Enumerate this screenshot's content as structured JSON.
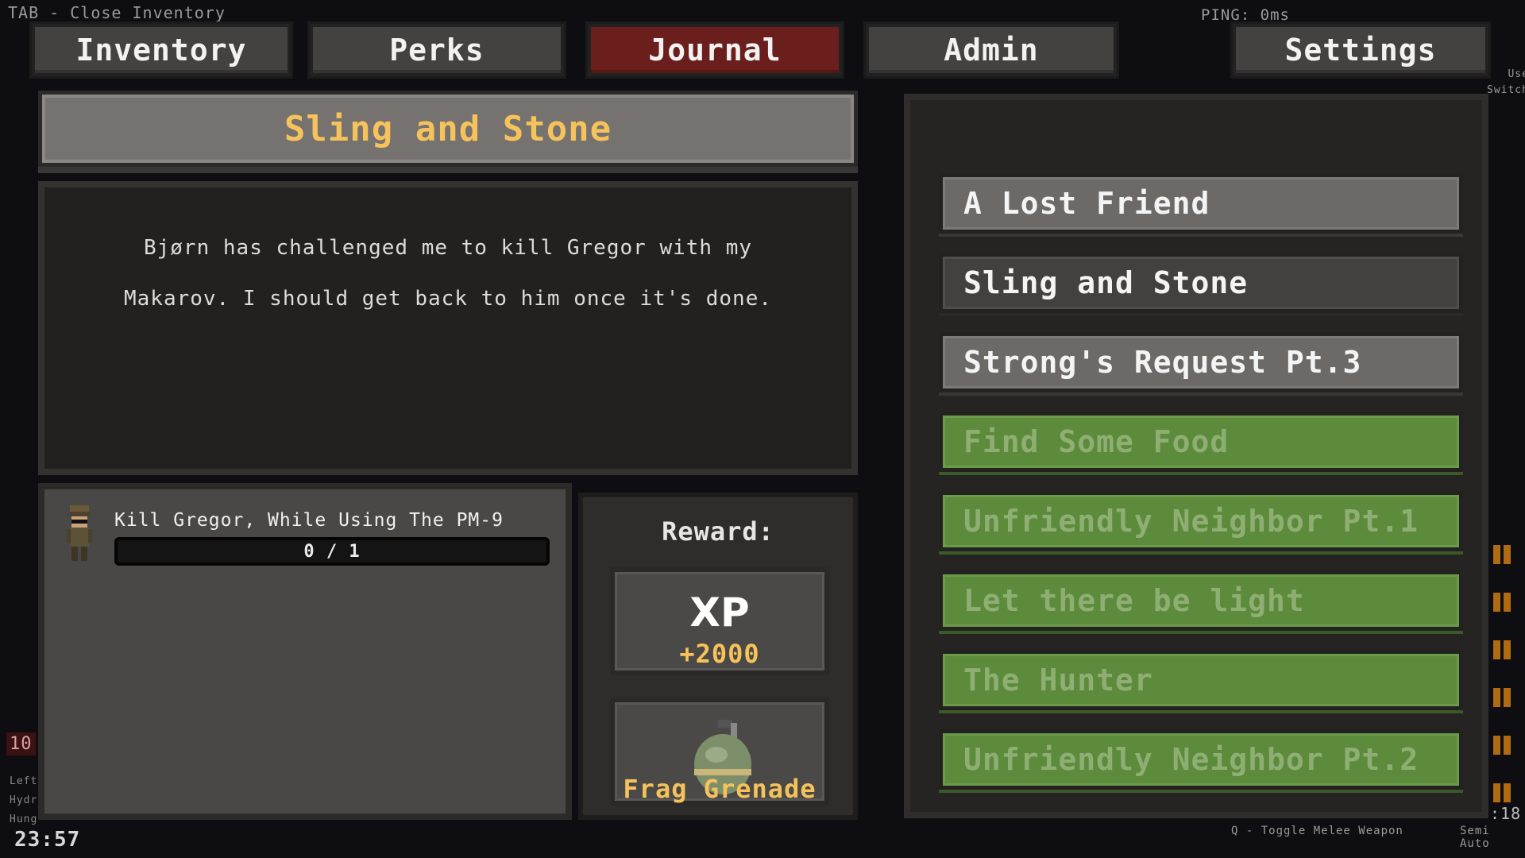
{
  "hud": {
    "close_hint": "TAB - Close Inventory",
    "ping": "PING: 0ms",
    "use_hint_1": "Use",
    "use_hint_2": "Switch",
    "health_value": "10",
    "stat_1": "Left",
    "stat_2": "Hydr",
    "stat_3": "Hung",
    "clock": "23:57",
    "melee_hint": "Q - Toggle Melee Weapon",
    "ammo": ":18",
    "fire_mode": "Semi Auto"
  },
  "tabs": [
    {
      "label": "Inventory"
    },
    {
      "label": "Perks"
    },
    {
      "label": "Journal"
    },
    {
      "label": "Admin"
    },
    {
      "label": "Settings"
    }
  ],
  "quest_detail": {
    "title": "Sling and Stone",
    "description": "Bjørn has challenged me to kill Gregor with my Makarov. I should get back to him once it's done.",
    "objective": {
      "label": "Kill Gregor, While Using The PM-9",
      "progress_text": "0 / 1",
      "current": 0,
      "total": 1
    },
    "reward_label": "Reward:",
    "rewards": [
      {
        "title": "XP",
        "value": "+2000",
        "icon": "xp-icon"
      },
      {
        "title": "Frag Grenade",
        "icon": "grenade-icon"
      }
    ]
  },
  "quests": [
    {
      "label": "A Lost Friend",
      "state": "active"
    },
    {
      "label": "Sling and Stone",
      "state": "selected"
    },
    {
      "label": "Strong's Request Pt.3",
      "state": "active"
    },
    {
      "label": "Find Some Food",
      "state": "completed"
    },
    {
      "label": "Unfriendly Neighbor Pt.1",
      "state": "completed"
    },
    {
      "label": "Let there be light",
      "state": "completed"
    },
    {
      "label": "The Hunter",
      "state": "completed"
    },
    {
      "label": "Unfriendly Neighbor Pt.2",
      "state": "completed"
    }
  ],
  "colors": {
    "active_tab": "#6b1f1d",
    "title_text": "#f6c25b",
    "completed_quest": "#5d8b3c"
  }
}
